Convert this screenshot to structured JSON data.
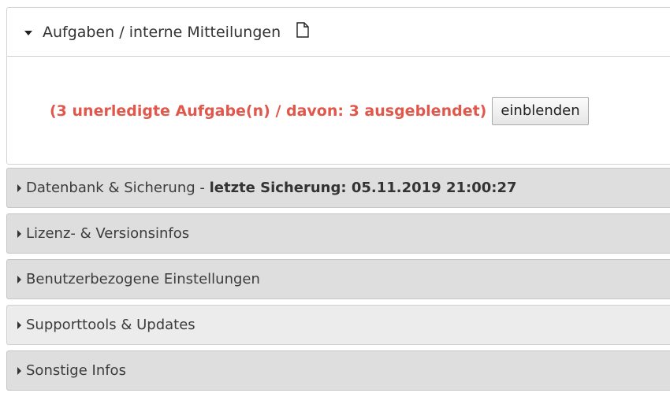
{
  "tasks_panel": {
    "title": "Aufgaben / interne Mitteilungen",
    "new_note_icon": "document-icon",
    "status_text": "(3 unerledigte Aufgabe(n) / davon: 3 ausgeblendet)",
    "show_button_label": "einblenden"
  },
  "sections": [
    {
      "label": "Datenbank & Sicherung",
      "separator": " - ",
      "detail": "letzte Sicherung: 05.11.2019 21:00:27"
    },
    {
      "label": "Lizenz- & Versionsinfos"
    },
    {
      "label": "Benutzerbezogene Einstellungen"
    },
    {
      "label": "Supporttools & Updates"
    },
    {
      "label": "Sonstige Infos"
    }
  ],
  "colors": {
    "status_text": "#e2574c",
    "collapsed_header_bg": "#dedede",
    "collapsed_header_bg_light": "#ececec"
  }
}
